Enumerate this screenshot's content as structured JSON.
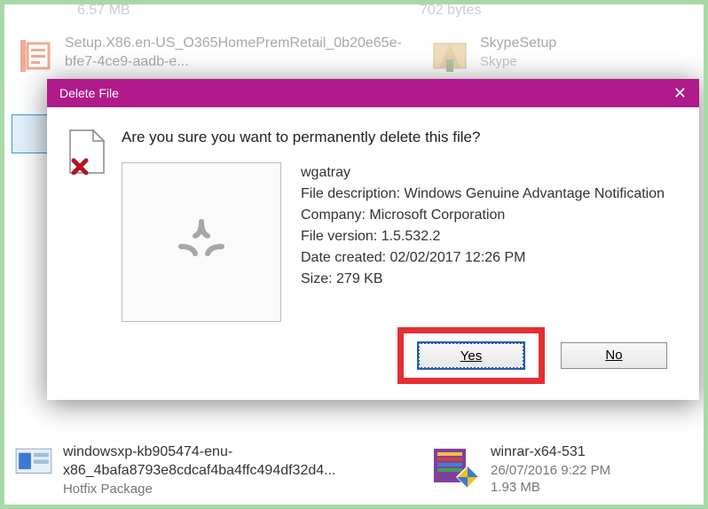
{
  "bg": {
    "partial_size": "6.57 MB",
    "partial_bytes": "702 bytes",
    "file1": {
      "name": "Setup.X86.en-US_O365HomePremRetail_0b20e65e-bfe7-4ce9-aadb-e..."
    },
    "file2": {
      "name": "SkypeSetup",
      "sub": "Skype"
    },
    "file3": {
      "name": "windowsxp-kb905474-enu-x86_4bafa8793e8cdcaf4ba4ffc494df32d4...",
      "sub": "Hotfix Package"
    },
    "file4": {
      "name": "winrar-x64-531",
      "date": "26/07/2016 9:22 PM",
      "size": "1.93 MB"
    }
  },
  "dialog": {
    "title": "Delete File",
    "prompt": "Are you sure you want to permanently delete this file?",
    "meta": {
      "name": "wgatray",
      "desc_label": "File description: ",
      "desc": "Windows Genuine Advantage Notification",
      "company_label": "Company: ",
      "company": "Microsoft Corporation",
      "version_label": "File version: ",
      "version": "1.5.532.2",
      "created_label": "Date created: ",
      "created": "02/02/2017 12:26 PM",
      "size_label": "Size: ",
      "size": "279 KB"
    },
    "yes_label": "Yes",
    "no_label": "No"
  }
}
